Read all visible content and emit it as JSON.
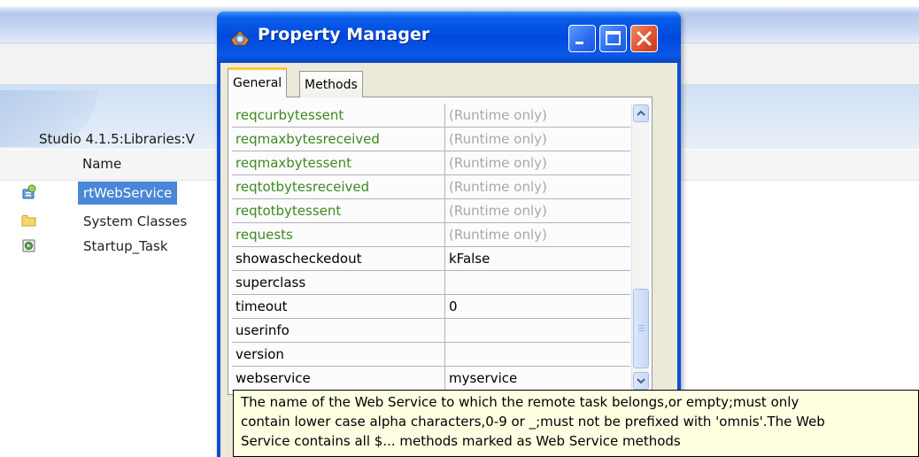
{
  "background_window": {
    "path_text": "Studio 4.1.5:Libraries:V",
    "column_header": "Name",
    "items": [
      {
        "label": "rtWebService",
        "selected": true,
        "icon": "remote-task-icon"
      },
      {
        "label": "System Classes",
        "selected": false,
        "icon": "folder-icon"
      },
      {
        "label": "Startup_Task",
        "selected": false,
        "icon": "task-icon"
      }
    ]
  },
  "property_manager": {
    "title": "Property Manager",
    "title_icon": "property-manager-icon",
    "window_buttons": [
      "minimize",
      "maximize",
      "close"
    ],
    "tabs": [
      {
        "label": "General",
        "active": true
      },
      {
        "label": "Methods",
        "active": false
      }
    ],
    "properties": [
      {
        "name": "reqcurbytessent",
        "value": "(Runtime only)",
        "runtime": true
      },
      {
        "name": "reqmaxbytesreceived",
        "value": "(Runtime only)",
        "runtime": true
      },
      {
        "name": "reqmaxbytessent",
        "value": "(Runtime only)",
        "runtime": true
      },
      {
        "name": "reqtotbytesreceived",
        "value": "(Runtime only)",
        "runtime": true
      },
      {
        "name": "reqtotbytessent",
        "value": "(Runtime only)",
        "runtime": true
      },
      {
        "name": "requests",
        "value": "(Runtime only)",
        "runtime": true
      },
      {
        "name": "showascheckedout",
        "value": "kFalse",
        "runtime": false
      },
      {
        "name": "superclass",
        "value": "",
        "runtime": false
      },
      {
        "name": "timeout",
        "value": "0",
        "runtime": false
      },
      {
        "name": "userinfo",
        "value": "",
        "runtime": false
      },
      {
        "name": "version",
        "value": "",
        "runtime": false
      },
      {
        "name": "webservice",
        "value": "myservice",
        "runtime": false
      }
    ]
  },
  "tooltip": {
    "lines": [
      "The name of the Web Service to which the remote task belongs,or empty;must only",
      "contain lower case alpha characters,0-9 or  _;must not be prefixed with 'omnis'.The Web",
      "Service contains all $... methods marked as Web Service methods"
    ]
  },
  "colors": {
    "runtime_name": "#3c8a1e",
    "runtime_value": "#a8a8a8",
    "selection": "#4a87d6",
    "titlebar": "#0049de",
    "tooltip_bg": "#ffffe1"
  }
}
